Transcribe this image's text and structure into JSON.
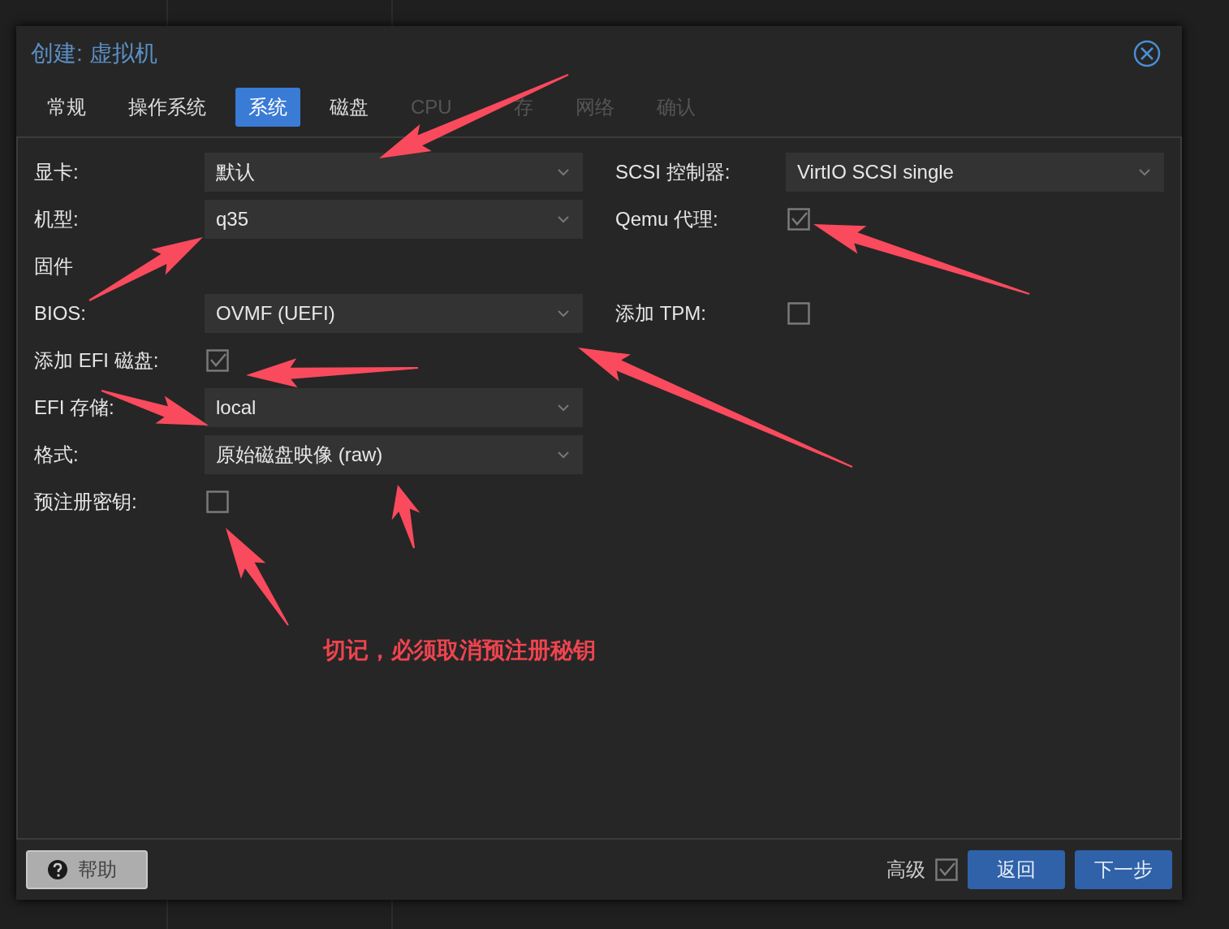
{
  "dialog": {
    "title": "创建: 虚拟机"
  },
  "tabs": [
    {
      "label": "常规",
      "selected": false,
      "disabled": false
    },
    {
      "label": "操作系统",
      "selected": false,
      "disabled": false
    },
    {
      "label": "系统",
      "selected": true,
      "disabled": false
    },
    {
      "label": "磁盘",
      "selected": false,
      "disabled": false
    },
    {
      "label": "CPU",
      "selected": false,
      "disabled": true
    },
    {
      "label": "存",
      "selected": false,
      "disabled": true
    },
    {
      "label": "网络",
      "selected": false,
      "disabled": true
    },
    {
      "label": "确认",
      "selected": false,
      "disabled": true
    }
  ],
  "rows": [
    {
      "left": {
        "kind": "select",
        "label": "显卡:",
        "value": "默认"
      },
      "right": {
        "kind": "select",
        "label": "SCSI 控制器:",
        "value": "VirtIO SCSI single"
      }
    },
    {
      "left": {
        "kind": "select",
        "label": "机型:",
        "value": "q35"
      },
      "right": {
        "kind": "checkbox",
        "label": "Qemu 代理:",
        "checked": true
      }
    },
    {
      "left": {
        "kind": "section",
        "label": "固件"
      }
    },
    {
      "left": {
        "kind": "select",
        "label": "BIOS:",
        "value": "OVMF (UEFI)"
      },
      "right": {
        "kind": "checkbox",
        "label": "添加 TPM:",
        "checked": false
      }
    },
    {
      "left": {
        "kind": "checkbox",
        "label": "添加 EFI 磁盘:",
        "checked": true
      }
    },
    {
      "left": {
        "kind": "select",
        "label": "EFI 存储:",
        "value": "local"
      }
    },
    {
      "left": {
        "kind": "select",
        "label": "格式:",
        "value": "原始磁盘映像 (raw)"
      }
    },
    {
      "left": {
        "kind": "checkbox",
        "label": "预注册密钥:",
        "checked": false
      }
    }
  ],
  "note": "切记，必须取消预注册秘钥",
  "footer": {
    "help": "帮助",
    "advanced": {
      "label": "高级",
      "checked": true
    },
    "back": "返回",
    "next": "下一步"
  }
}
